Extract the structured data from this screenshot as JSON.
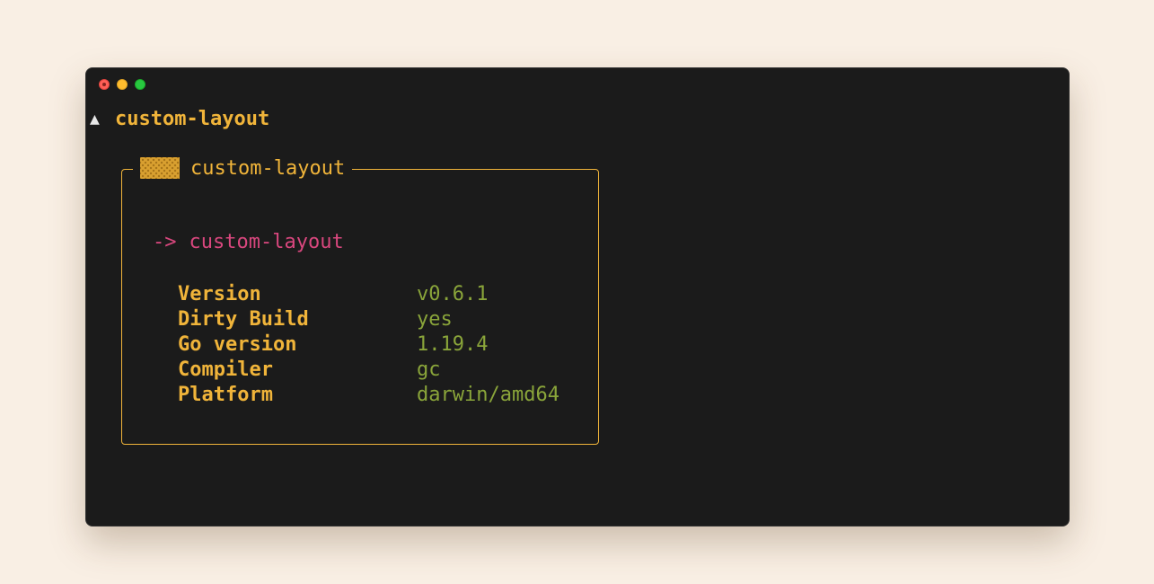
{
  "window": {
    "traffic_lights": [
      "close",
      "minimize",
      "zoom"
    ]
  },
  "prompt": {
    "arrow": "▲",
    "title": "custom-layout"
  },
  "panel": {
    "icon": "pattern-block-icon",
    "title": "custom-layout",
    "command_arrow": "->",
    "command_name": "custom-layout",
    "rows": [
      {
        "key": "Version",
        "value": "v0.6.1"
      },
      {
        "key": "Dirty Build",
        "value": "yes"
      },
      {
        "key": "Go version",
        "value": "1.19.4"
      },
      {
        "key": "Compiler",
        "value": "gc"
      },
      {
        "key": "Platform",
        "value": "darwin/amd64"
      }
    ]
  },
  "colors": {
    "background": "#f9efe4",
    "terminal": "#1b1b1b",
    "accent_yellow": "#f0b43a",
    "accent_pink": "#d9477e",
    "accent_green": "#8aa53a"
  }
}
